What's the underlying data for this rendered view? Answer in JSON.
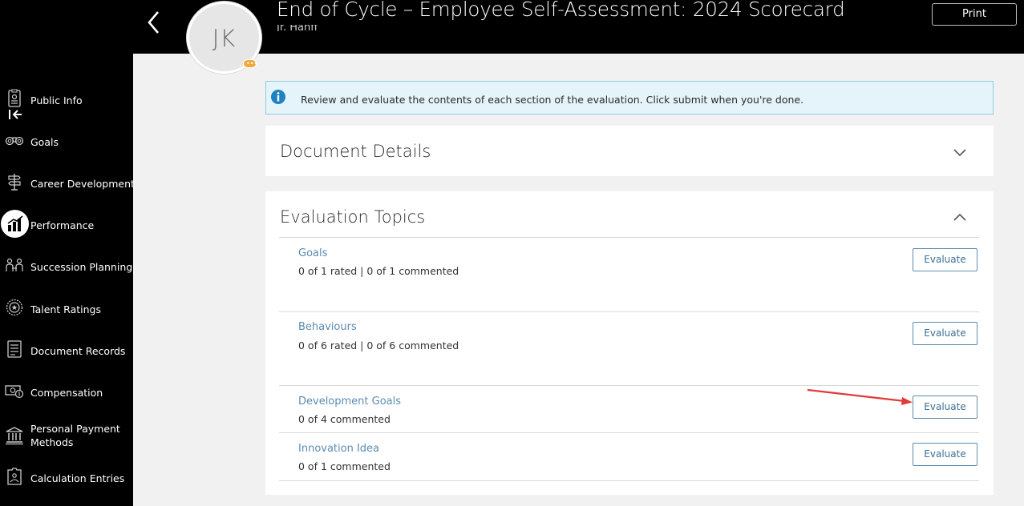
{
  "header": {
    "title": "End of Cycle – Employee Self-Assessment: 2024 Scorecard",
    "subtitle": "Jr. Hanff",
    "print_label": "Print",
    "avatar_initials": "JK",
    "avatar_badge": "•••"
  },
  "sidebar": {
    "items": [
      {
        "label": "Public Info",
        "icon": "badge-icon"
      },
      {
        "label": "Goals",
        "icon": "binoculars-icon"
      },
      {
        "label": "Career Development",
        "icon": "signpost-icon"
      },
      {
        "label": "Performance",
        "icon": "bar-chart-icon",
        "active": true
      },
      {
        "label": "Succession Planning",
        "icon": "people-icon"
      },
      {
        "label": "Talent Ratings",
        "icon": "rating-seal-icon"
      },
      {
        "label": "Document Records",
        "icon": "document-icon"
      },
      {
        "label": "Compensation",
        "icon": "money-icon"
      },
      {
        "label": "Personal Payment Methods",
        "icon": "bank-icon"
      },
      {
        "label": "Calculation Entries",
        "icon": "calculator-icon"
      }
    ]
  },
  "info": {
    "text": "Review and evaluate the contents of each section of the evaluation. Click submit when you're done."
  },
  "document_details": {
    "title": "Document Details"
  },
  "evaluation_topics": {
    "title": "Evaluation Topics",
    "evaluate_label": "Evaluate",
    "topics": [
      {
        "name": "Goals",
        "status": "0 of 1 rated | 0 of 1 commented"
      },
      {
        "name": "Behaviours",
        "status": "0 of 6 rated | 0 of 6 commented"
      },
      {
        "name": "Development Goals",
        "status": "0 of 4 commented"
      },
      {
        "name": "Innovation Idea",
        "status": "0 of 1 commented"
      }
    ]
  },
  "colors": {
    "accent": "#5b8cb1",
    "info_bg": "#e5f4fa",
    "annotation_arrow": "#e03a3a",
    "sidebar_bg": "#000000"
  }
}
